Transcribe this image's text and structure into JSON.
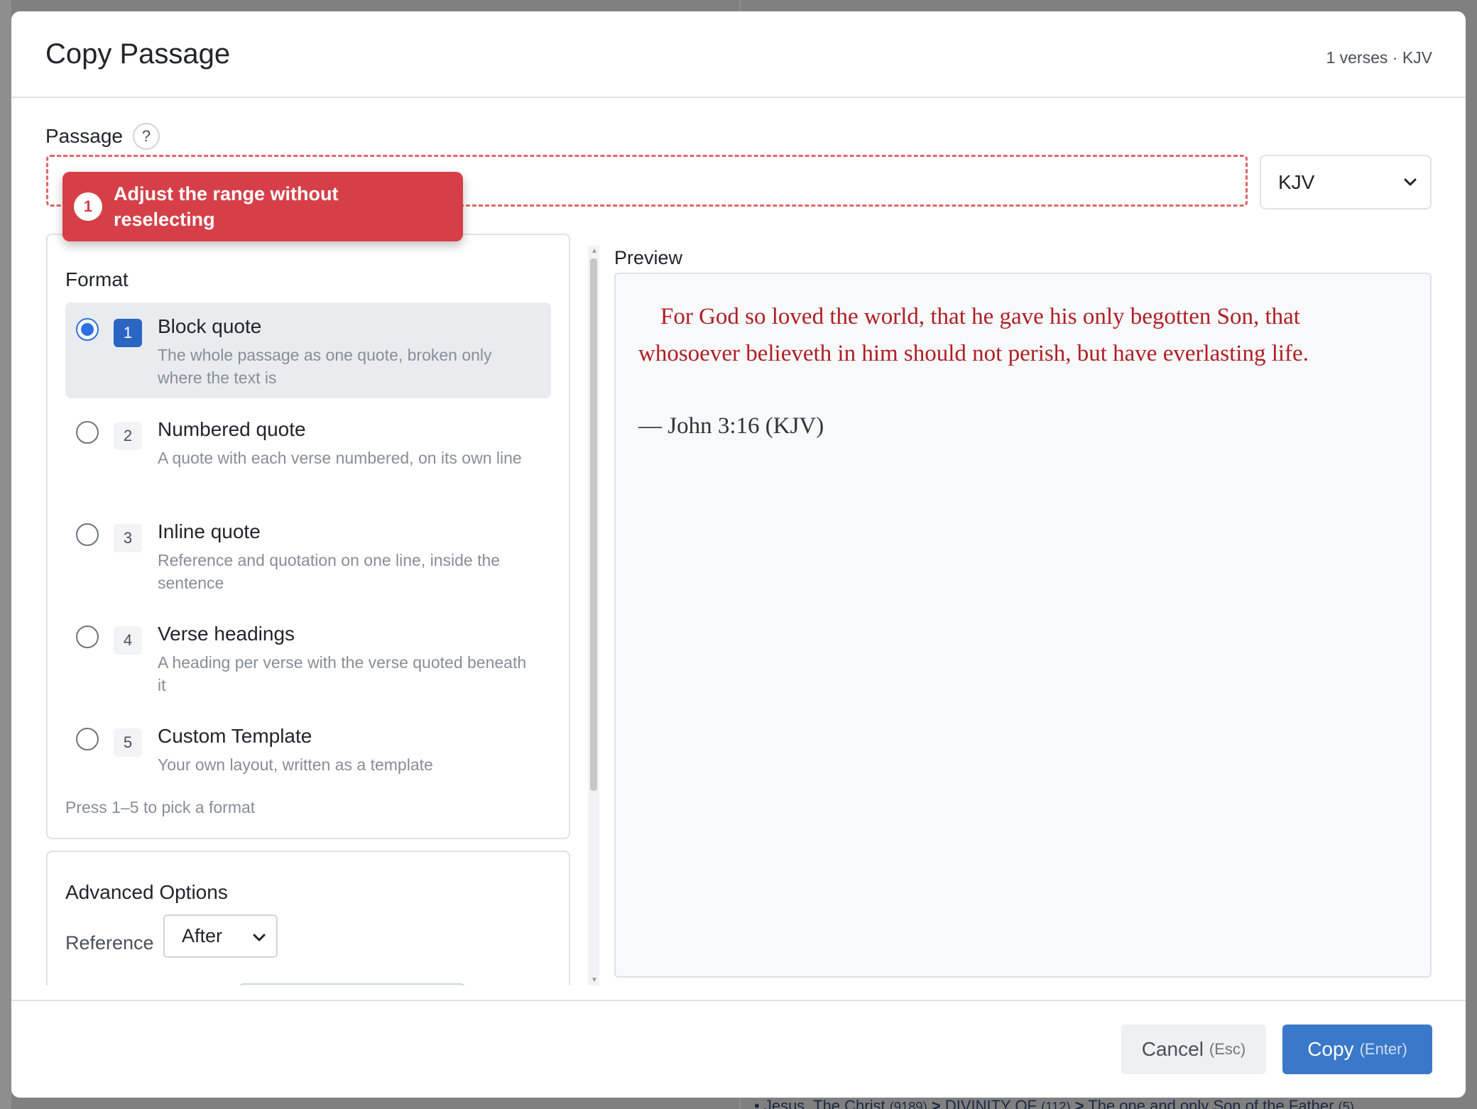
{
  "modal": {
    "title": "Copy Passage",
    "meta": "1 verses · KJV"
  },
  "passage": {
    "label": "Passage",
    "help_glyph": "?",
    "input_value": "",
    "version_selected": "KJV"
  },
  "tooltip": {
    "step": "1",
    "text": "Adjust the range without reselecting"
  },
  "format": {
    "title": "Format",
    "options": [
      {
        "num": "1",
        "name": "Block quote",
        "desc": "The whole passage as one quote, broken only where the text is",
        "selected": true
      },
      {
        "num": "2",
        "name": "Numbered quote",
        "desc": "A quote with each verse numbered, on its own line",
        "selected": false
      },
      {
        "num": "3",
        "name": "Inline quote",
        "desc": "Reference and quotation on one line, inside the sentence",
        "selected": false
      },
      {
        "num": "4",
        "name": "Verse headings",
        "desc": "A heading per verse with the verse quoted beneath it",
        "selected": false
      },
      {
        "num": "5",
        "name": "Custom Template",
        "desc": "Your own layout, written as a template",
        "selected": false
      }
    ],
    "hint": "Press 1–5 to pick a format"
  },
  "advanced": {
    "title": "Advanced Options",
    "reference_label": "Reference",
    "reference_value": "After"
  },
  "preview": {
    "label": "Preview",
    "text": "For God so loved the world, that he gave his only begotten Son, that whosoever believeth in him should not perish, but have everlasting life.",
    "reference": "— John 3:16 (KJV)"
  },
  "footer": {
    "cancel_label": "Cancel",
    "cancel_key": "(Esc)",
    "copy_label": "Copy",
    "copy_key": "(Enter)"
  },
  "colors": {
    "accent": "#3a78c9",
    "tooltip": "#d63f47",
    "verse_text": "#b01e24"
  },
  "background": {
    "breadcrumb": [
      "Jesus, The Christ",
      "(9189)",
      ">",
      "DIVINITY OF",
      "(112)",
      ">",
      "The one and only Son of the Father",
      "(5)"
    ]
  }
}
